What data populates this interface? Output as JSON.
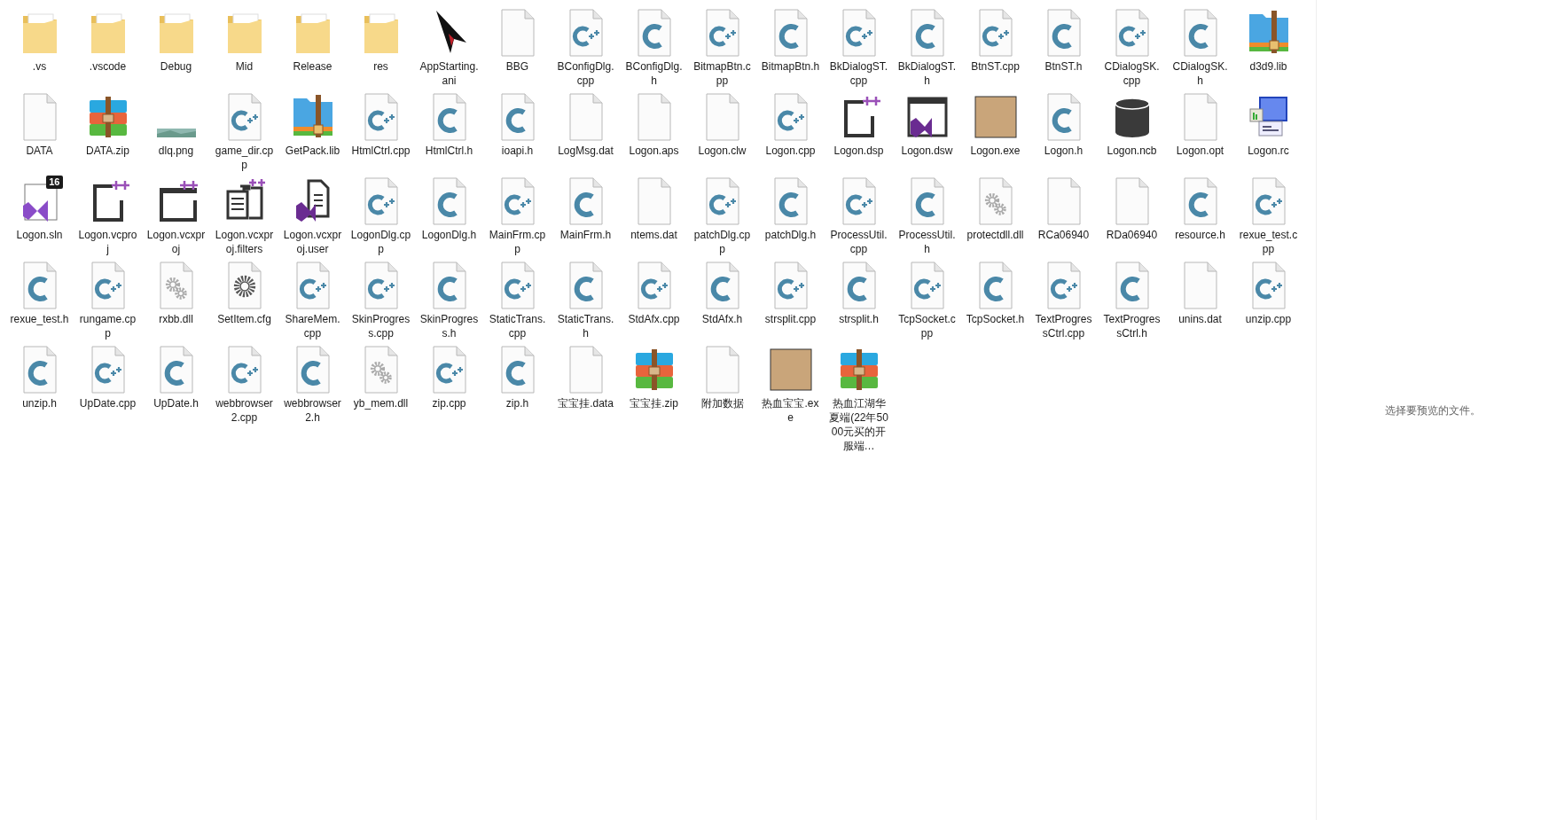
{
  "files": [
    {
      "name": ".vs",
      "kind": "folder"
    },
    {
      "name": ".vscode",
      "kind": "folder"
    },
    {
      "name": "Debug",
      "kind": "folder"
    },
    {
      "name": "Mid",
      "kind": "folder"
    },
    {
      "name": "Release",
      "kind": "folder"
    },
    {
      "name": "res",
      "kind": "folder"
    },
    {
      "name": "AppStarting.ani",
      "kind": "cursor"
    },
    {
      "name": "BBG",
      "kind": "file"
    },
    {
      "name": "BConfigDlg.cpp",
      "kind": "cpp"
    },
    {
      "name": "BConfigDlg.h",
      "kind": "c"
    },
    {
      "name": "BitmapBtn.cpp",
      "kind": "cpp"
    },
    {
      "name": "BitmapBtn.h",
      "kind": "c"
    },
    {
      "name": "BkDialogST.cpp",
      "kind": "cpp"
    },
    {
      "name": "BkDialogST.h",
      "kind": "c"
    },
    {
      "name": "BtnST.cpp",
      "kind": "cpp"
    },
    {
      "name": "BtnST.h",
      "kind": "c"
    },
    {
      "name": "CDialogSK.cpp",
      "kind": "cpp"
    },
    {
      "name": "CDialogSK.h",
      "kind": "c"
    },
    {
      "name": "d3d9.lib",
      "kind": "zip360"
    },
    {
      "name": "DATA",
      "kind": "file"
    },
    {
      "name": "DATA.zip",
      "kind": "zip"
    },
    {
      "name": "dlq.png",
      "kind": "image"
    },
    {
      "name": "game_dir.cpp",
      "kind": "cpp"
    },
    {
      "name": "GetPack.lib",
      "kind": "zip360"
    },
    {
      "name": "HtmlCtrl.cpp",
      "kind": "cpp"
    },
    {
      "name": "HtmlCtrl.h",
      "kind": "c"
    },
    {
      "name": "ioapi.h",
      "kind": "c"
    },
    {
      "name": "LogMsg.dat",
      "kind": "file"
    },
    {
      "name": "Logon.aps",
      "kind": "file"
    },
    {
      "name": "Logon.clw",
      "kind": "file"
    },
    {
      "name": "Logon.cpp",
      "kind": "cpp"
    },
    {
      "name": "Logon.dsp",
      "kind": "dsp"
    },
    {
      "name": "Logon.dsw",
      "kind": "dsw"
    },
    {
      "name": "Logon.exe",
      "kind": "photo"
    },
    {
      "name": "Logon.h",
      "kind": "c"
    },
    {
      "name": "Logon.ncb",
      "kind": "db"
    },
    {
      "name": "Logon.opt",
      "kind": "file"
    },
    {
      "name": "Logon.rc",
      "kind": "rc"
    },
    {
      "name": "Logon.sln",
      "kind": "sln",
      "badge": "16"
    },
    {
      "name": "Logon.vcproj",
      "kind": "vcproj"
    },
    {
      "name": "Logon.vcxproj",
      "kind": "vcxproj"
    },
    {
      "name": "Logon.vcxproj.filters",
      "kind": "filters"
    },
    {
      "name": "Logon.vcxproj.user",
      "kind": "user"
    },
    {
      "name": "LogonDlg.cpp",
      "kind": "cpp"
    },
    {
      "name": "LogonDlg.h",
      "kind": "c"
    },
    {
      "name": "MainFrm.cpp",
      "kind": "cpp"
    },
    {
      "name": "MainFrm.h",
      "kind": "c"
    },
    {
      "name": "ntems.dat",
      "kind": "file"
    },
    {
      "name": "patchDlg.cpp",
      "kind": "cpp"
    },
    {
      "name": "patchDlg.h",
      "kind": "c"
    },
    {
      "name": "ProcessUtil.cpp",
      "kind": "cpp"
    },
    {
      "name": "ProcessUtil.h",
      "kind": "c"
    },
    {
      "name": "protectdll.dll",
      "kind": "dll"
    },
    {
      "name": "RCa06940",
      "kind": "file"
    },
    {
      "name": "RDa06940",
      "kind": "file"
    },
    {
      "name": "resource.h",
      "kind": "c"
    },
    {
      "name": "rexue_test.cpp",
      "kind": "cpp"
    },
    {
      "name": "rexue_test.h",
      "kind": "c"
    },
    {
      "name": "rungame.cpp",
      "kind": "cpp"
    },
    {
      "name": "rxbb.dll",
      "kind": "dll"
    },
    {
      "name": "SetItem.cfg",
      "kind": "cfg"
    },
    {
      "name": "ShareMem.cpp",
      "kind": "cpp"
    },
    {
      "name": "SkinProgress.cpp",
      "kind": "cpp"
    },
    {
      "name": "SkinProgress.h",
      "kind": "c"
    },
    {
      "name": "StaticTrans.cpp",
      "kind": "cpp"
    },
    {
      "name": "StaticTrans.h",
      "kind": "c"
    },
    {
      "name": "StdAfx.cpp",
      "kind": "cpp"
    },
    {
      "name": "StdAfx.h",
      "kind": "c"
    },
    {
      "name": "strsplit.cpp",
      "kind": "cpp"
    },
    {
      "name": "strsplit.h",
      "kind": "c"
    },
    {
      "name": "TcpSocket.cpp",
      "kind": "cpp"
    },
    {
      "name": "TcpSocket.h",
      "kind": "c"
    },
    {
      "name": "TextProgressCtrl.cpp",
      "kind": "cpp"
    },
    {
      "name": "TextProgressCtrl.h",
      "kind": "c"
    },
    {
      "name": "unins.dat",
      "kind": "file"
    },
    {
      "name": "unzip.cpp",
      "kind": "cpp"
    },
    {
      "name": "unzip.h",
      "kind": "c"
    },
    {
      "name": "UpDate.cpp",
      "kind": "cpp"
    },
    {
      "name": "UpDate.h",
      "kind": "c"
    },
    {
      "name": "webbrowser2.cpp",
      "kind": "cpp"
    },
    {
      "name": "webbrowser2.h",
      "kind": "c"
    },
    {
      "name": "yb_mem.dll",
      "kind": "dll"
    },
    {
      "name": "zip.cpp",
      "kind": "cpp"
    },
    {
      "name": "zip.h",
      "kind": "c"
    },
    {
      "name": "宝宝挂.data",
      "kind": "file"
    },
    {
      "name": "宝宝挂.zip",
      "kind": "zip"
    },
    {
      "name": "附加数据",
      "kind": "file"
    },
    {
      "name": "热血宝宝.exe",
      "kind": "photo"
    },
    {
      "name": "热血江湖华夏端(22年5000元买的开服端…",
      "kind": "zip"
    }
  ],
  "preview": {
    "message": "选择要预览的文件。"
  }
}
